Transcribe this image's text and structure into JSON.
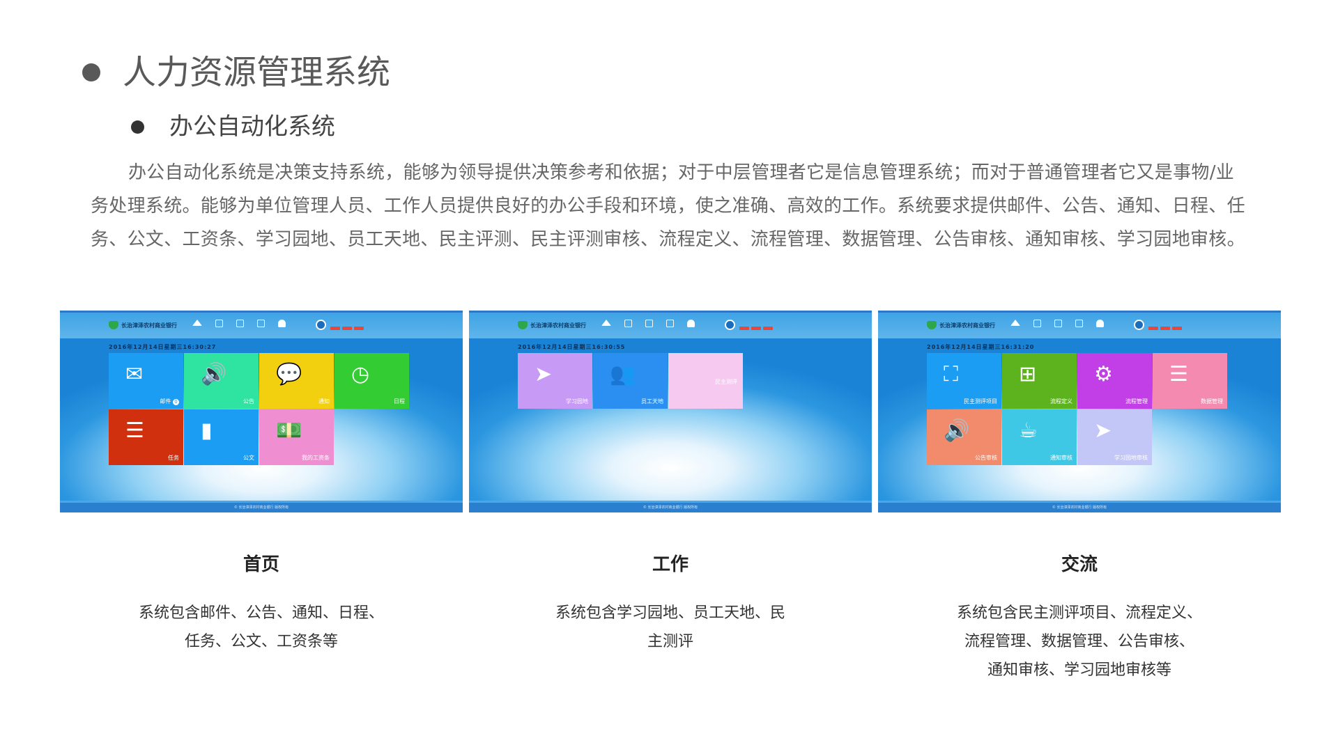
{
  "heading": "人力资源管理系统",
  "subheading": "办公自动化系统",
  "paragraph": "办公自动化系统是决策支持系统，能够为领导提供决策参考和依据；对于中层管理者它是信息管理系统；而对于普通管理者它又是事物/业务处理系统。能够为单位管理人员、工作人员提供良好的办公手段和环境，使之准确、高效的工作。系统要求提供邮件、公告、通知、日程、任务、公文、工资条、学习园地、员工天地、民主评测、民主评测审核、流程定义、流程管理、数据管理、公告审核、通知审核、学习园地审核。",
  "screenshots": [
    {
      "app_name": "长治漳泽农村商业银行",
      "datetime": "2016年12月14日星期三16:30:27",
      "footer": "© 长治漳泽农村商业银行 版权所有",
      "tiles": [
        {
          "label": "邮件",
          "badge": "0",
          "color": "#1a9df2",
          "icon": "mail-icon"
        },
        {
          "label": "公告",
          "color": "#2fe3a0",
          "icon": "speaker-icon"
        },
        {
          "label": "通知",
          "color": "#f2cf0f",
          "icon": "chat-icon"
        },
        {
          "label": "日程",
          "color": "#33cc33",
          "icon": "clock-icon"
        },
        {
          "label": "任务",
          "color": "#d0300e",
          "icon": "list-icon"
        },
        {
          "label": "公文",
          "color": "#1a9df2",
          "icon": "document-icon"
        },
        {
          "label": "我的工资条",
          "color": "#ef8fd1",
          "icon": "money-icon"
        }
      ]
    },
    {
      "app_name": "长治漳泽农村商业银行",
      "datetime": "2016年12月14日星期三16:30:55",
      "footer": "© 长治漳泽农村商业银行 版权所有",
      "tiles": [
        {
          "label": "学习园地",
          "color": "#c79af5",
          "icon": "paper-plane-icon"
        },
        {
          "label": "员工天地",
          "color": "#2a8ff0",
          "icon": "users-icon"
        },
        {
          "label": "民主测评",
          "color": "#f5c9f0",
          "icon": ""
        }
      ]
    },
    {
      "app_name": "长治漳泽农村商业银行",
      "datetime": "2016年12月14日星期三16:31:20",
      "footer": "© 长治漳泽农村商业银行 版权所有",
      "tiles": [
        {
          "label": "民主测评项目",
          "color": "#1a9df2",
          "icon": "frame-icon"
        },
        {
          "label": "流程定义",
          "color": "#5db31d",
          "icon": "sitemap-icon"
        },
        {
          "label": "流程管理",
          "color": "#c23ee6",
          "icon": "gear-icon"
        },
        {
          "label": "数据管理",
          "color": "#f58ab0",
          "icon": "database-icon"
        },
        {
          "label": "公告审核",
          "color": "#f28b6b",
          "icon": "speaker-icon"
        },
        {
          "label": "通知审核",
          "color": "#3fc8e6",
          "icon": "cup-icon"
        },
        {
          "label": "学习园地审核",
          "color": "#c3c7f7",
          "icon": "paper-plane-icon"
        }
      ]
    }
  ],
  "captions": [
    {
      "title": "首页",
      "desc_line1": "系统包含邮件、公告、通知、日程、",
      "desc_line2": "任务、公文、工资条等",
      "desc_line3": ""
    },
    {
      "title": "工作",
      "desc_line1": "系统包含学习园地、员工天地、民",
      "desc_line2": "主测评",
      "desc_line3": ""
    },
    {
      "title": "交流",
      "desc_line1": "系统包含民主测评项目、流程定义、",
      "desc_line2": "流程管理、数据管理、公告审核、",
      "desc_line3": "通知审核、学习园地审核等"
    }
  ]
}
